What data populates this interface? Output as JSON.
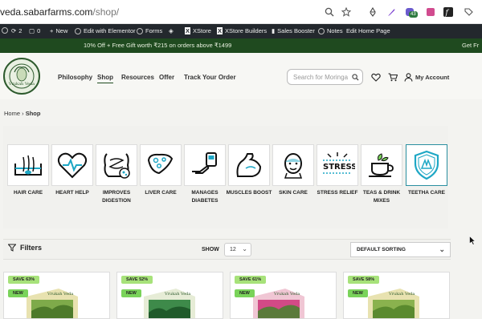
{
  "browser": {
    "url_host": "veda.sabarfarms.com",
    "url_path": "/shop/",
    "extension_badge": "43"
  },
  "admin_bar": {
    "updates_count": "2",
    "comments_count": "0",
    "new_label": "New",
    "elementor_label": "Edit with Elementor",
    "forms_label": "Forms",
    "xstore_label": "XStore",
    "xstore_builders_label": "XStore Builders",
    "sales_booster_label": "Sales Booster",
    "notes_label": "Notes",
    "edit_home_label": "Edit Home Page"
  },
  "promo": {
    "text": "10% Off + Free Gift worth ₹215 on orders above ₹1499",
    "text_repeat": "Get Fr"
  },
  "header": {
    "logo_text": "Vrukah Veda",
    "nav": [
      "Philosophy",
      "Shop",
      "Resources",
      "Offer",
      "Track Your Order"
    ],
    "active_nav": "Shop",
    "search_placeholder": "Search for Moringa",
    "account_label": "My Account"
  },
  "breadcrumb": {
    "home": "Home",
    "separator": "›",
    "current": "Shop"
  },
  "categories": [
    {
      "label": "HAIR CARE",
      "icon": "hair-follicle-icon"
    },
    {
      "label": "HEART HELP",
      "icon": "heart-pulse-icon"
    },
    {
      "label": "IMPROVES DIGESTION",
      "icon": "intestine-icon"
    },
    {
      "label": "LIVER CARE",
      "icon": "liver-icon"
    },
    {
      "label": "MANAGES DIABETES",
      "icon": "glucose-meter-icon"
    },
    {
      "label": "MUSCLES BOOST",
      "icon": "muscle-arm-icon"
    },
    {
      "label": "SKIN CARE",
      "icon": "face-mask-icon"
    },
    {
      "label": "STRESS RELIEF",
      "icon": "stress-icon"
    },
    {
      "label": "TEAS & DRINK MIXES",
      "icon": "tea-cup-icon"
    },
    {
      "label": "TEETHA CARE",
      "icon": "shield-hand-icon"
    }
  ],
  "toolbar": {
    "filters_label": "Filters",
    "show_label": "SHOW",
    "per_page": "12",
    "sort_label": "DEFAULT SORTING"
  },
  "products": [
    {
      "save": "SAVE 63%",
      "new": "NEW"
    },
    {
      "save": "SAVE 52%",
      "new": "NEW"
    },
    {
      "save": "SAVE 61%",
      "new": "NEW"
    },
    {
      "save": "SAVE 58%",
      "new": "NEW"
    }
  ],
  "colors": {
    "brand_green": "#1f4a1f",
    "badge_save": "#a7e27a",
    "badge_new": "#7ad35a",
    "admin_bar": "#23282d"
  }
}
